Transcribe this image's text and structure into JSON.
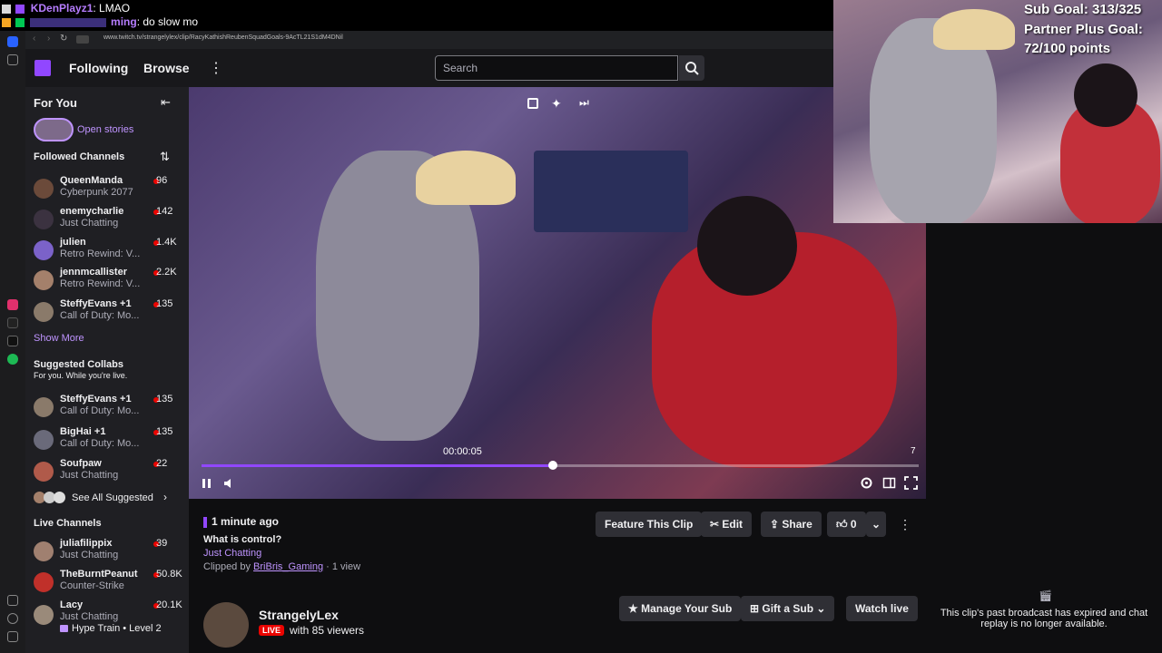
{
  "chat_overlay": {
    "line1_user": "KDenPlayz1",
    "line1_msg": ": LMAO",
    "line2_user": "ming",
    "line2_msg": ": do slow mo"
  },
  "browser": {
    "url": "www.twitch.tv/strangelylex/clip/RacyKathishReubenSquadGoals-9AcTL21S1dM4DNil"
  },
  "nav": {
    "following": "Following",
    "browse": "Browse",
    "more": "⋮",
    "search_placeholder": "Search"
  },
  "sidebar": {
    "for_you": "For You",
    "open_stories": "Open stories",
    "followed_title": "Followed Channels",
    "followed": [
      {
        "name": "QueenManda",
        "game": "Cyberpunk 2077",
        "viewers": "96"
      },
      {
        "name": "enemycharlie",
        "game": "Just Chatting",
        "viewers": "142"
      },
      {
        "name": "julien",
        "game": "Retro Rewind: V...",
        "viewers": "1.4K"
      },
      {
        "name": "jennmcallister",
        "game": "Retro Rewind: V...",
        "viewers": "2.2K"
      },
      {
        "name": "SteffyEvans +1",
        "game": "Call of Duty: Mo...",
        "viewers": "135"
      }
    ],
    "show_more": "Show More",
    "suggested_title": "Suggested Collabs",
    "suggested_sub": "For you. While you're live.",
    "suggested": [
      {
        "name": "SteffyEvans +1",
        "game": "Call of Duty: Mo...",
        "viewers": "135"
      },
      {
        "name": "BigHai +1",
        "game": "Call of Duty: Mo...",
        "viewers": "135"
      },
      {
        "name": "Soufpaw",
        "game": "Just Chatting",
        "viewers": "22"
      }
    ],
    "see_all": "See All Suggested",
    "live_title": "Live Channels",
    "live": [
      {
        "name": "juliafilippix",
        "game": "Just Chatting",
        "viewers": "39"
      },
      {
        "name": "TheBurntPeanut",
        "game": "Counter-Strike",
        "viewers": "50.8K"
      },
      {
        "name": "Lacy",
        "game": "Just Chatting",
        "viewers": "20.1K"
      }
    ],
    "hype_train": "Hype Train • Level 2"
  },
  "video": {
    "timestamp": "00:00:05",
    "end_label": "7",
    "progress": 0.49
  },
  "clip": {
    "time_ago": "1 minute ago",
    "title": "What is control?",
    "category": "Just Chatting",
    "clipped_by_prefix": "Clipped by",
    "clipper": "BriBris_Gaming",
    "views": "· 1 view",
    "feature": "Feature This Clip",
    "edit": "Edit",
    "share": "Share",
    "likes": "0"
  },
  "channel": {
    "name": "StrangelyLex",
    "live": "LIVE",
    "viewers": "with 85 viewers",
    "manage_sub": "Manage Your Sub",
    "gift_sub": "Gift a Sub",
    "watch_live": "Watch live"
  },
  "webcam": {
    "goal1": "Sub Goal: 313/325",
    "goal2": "Partner Plus Goal:",
    "goal3": "72/100 points"
  },
  "right_panel": {
    "expired": "This clip's past broadcast has expired and chat replay is no longer available."
  }
}
